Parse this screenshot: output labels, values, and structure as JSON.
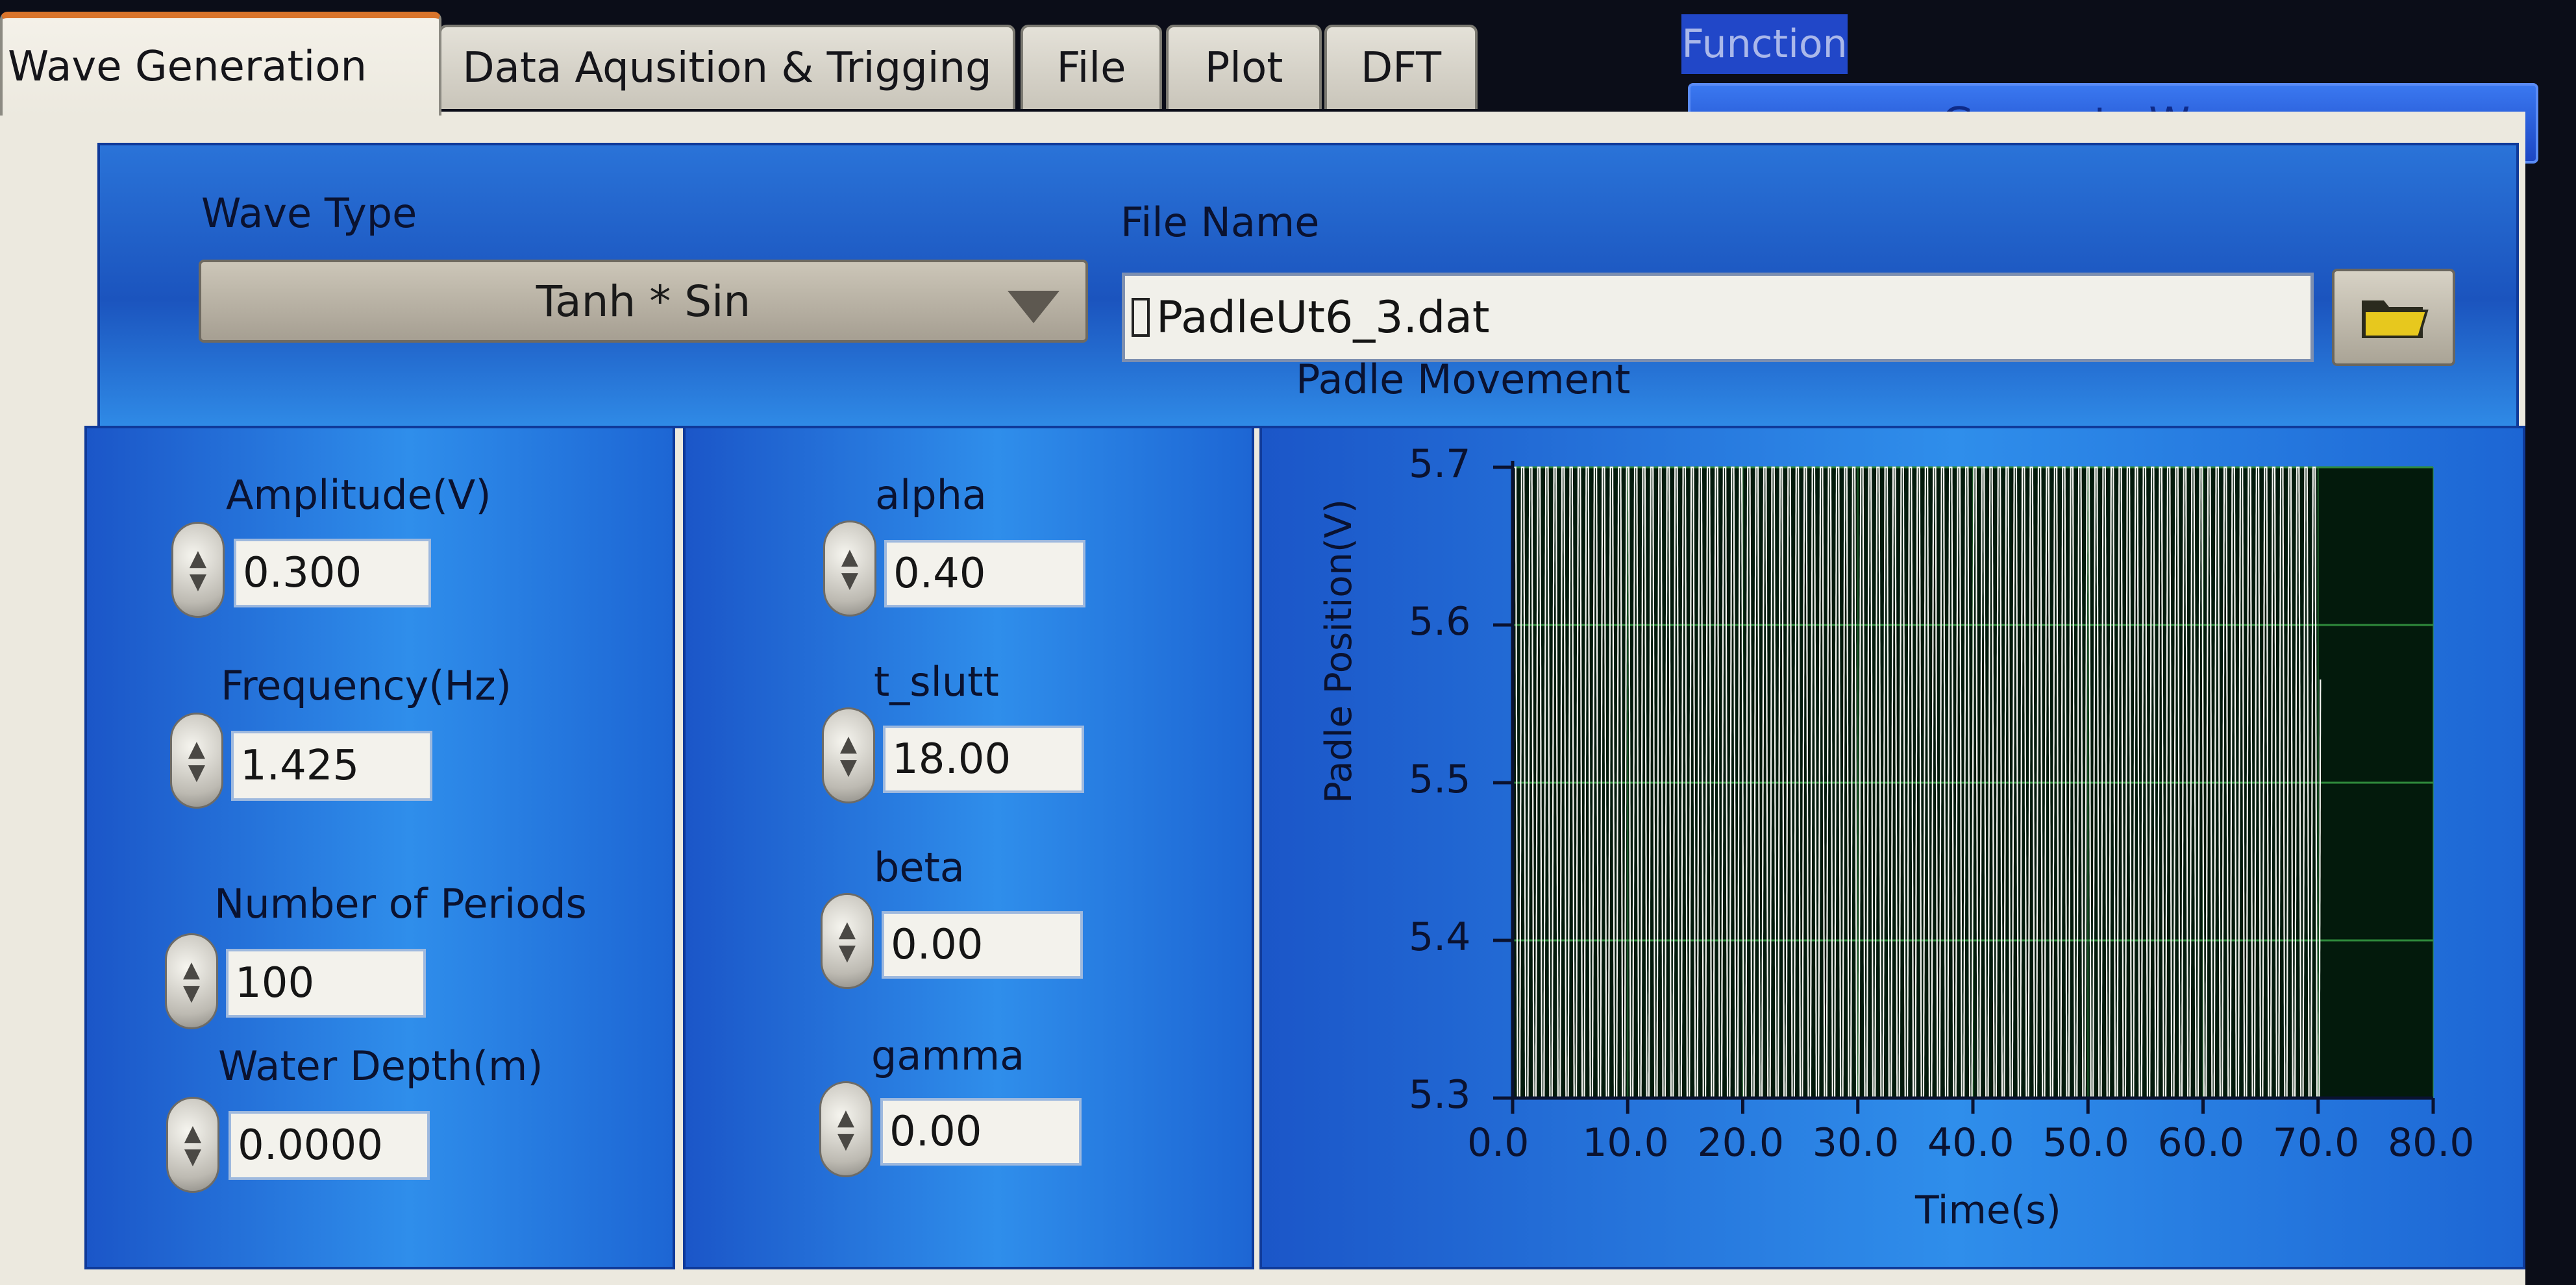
{
  "tabs": [
    "Wave Generation",
    "Data Aqusition & Trigging",
    "File",
    "Plot",
    "DFT"
  ],
  "function": {
    "label": "Function",
    "value": "Generate Waves"
  },
  "wave_type": {
    "label": "Wave Type",
    "value": "Tanh * Sin"
  },
  "file_name": {
    "label": "File Name",
    "value": "PadleUt6_3.dat"
  },
  "controls_left": [
    {
      "label": "Amplitude(V)",
      "value": "0.300"
    },
    {
      "label": "Frequency(Hz)",
      "value": "1.425"
    },
    {
      "label": "Number of Periods",
      "value": "100"
    },
    {
      "label": "Water Depth(m)",
      "value": "0.0000"
    }
  ],
  "controls_mid": [
    {
      "label": "alpha",
      "value": "0.40"
    },
    {
      "label": "t_slutt",
      "value": "18.00"
    },
    {
      "label": "beta",
      "value": "0.00"
    },
    {
      "label": "gamma",
      "value": "0.00"
    }
  ],
  "colors": {
    "accent": "#1b56c8",
    "plot_bg": "#031a0c",
    "trace": "#f4f4f0",
    "tab_active": "#d9742b"
  },
  "chart_data": {
    "type": "line",
    "title": "Padle Movement",
    "xlabel": "Time(s)",
    "ylabel": "Padle Position(V)",
    "xlim": [
      0,
      80
    ],
    "ylim": [
      5.3,
      5.7
    ],
    "x_ticks": [
      "0.0",
      "10.0",
      "20.0",
      "30.0",
      "40.0",
      "50.0",
      "60.0",
      "70.0",
      "80.0"
    ],
    "y_ticks": [
      "5.3",
      "5.4",
      "5.5",
      "5.6",
      "5.7"
    ],
    "grid": true,
    "series": [
      {
        "baseline": 5.5,
        "amplitude": 0.3,
        "frequency_hz": 1.425,
        "t_end": 70.2,
        "color": "#f4f4f0"
      }
    ]
  }
}
